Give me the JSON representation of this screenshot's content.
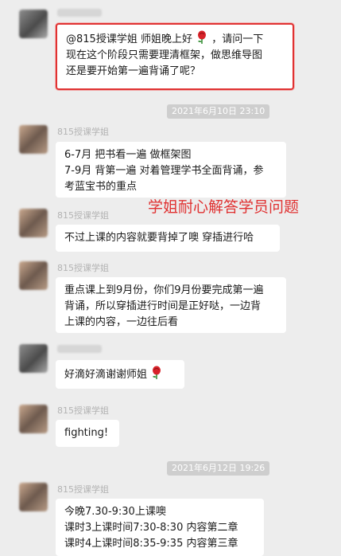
{
  "messages": {
    "m1": {
      "lines": [
        "@815授课学姐 师姐晚上好",
        "，请问一下",
        "现在这个阶段只需要理清框架，做思维导图",
        "还是要开始第一遍背诵了呢？"
      ]
    },
    "time1": "2021年6月10日 23:10",
    "m2": {
      "sender": "815授课学姐",
      "lines": [
        "6-7月 把书看一遍 做框架图",
        "7-9月 背第一遍 对着管理学书全面背诵，参",
        "考蓝宝书的重点"
      ]
    },
    "annotation": "学姐耐心解答学员问题",
    "m3": {
      "sender": "815授课学姐",
      "lines": [
        "不过上课的内容就要背掉了噢 穿插进行哈"
      ]
    },
    "m4": {
      "sender": "815授课学姐",
      "lines": [
        "重点课上到9月份，你们9月份要完成第一遍",
        "背诵，所以穿插进行时间是正好哒，一边背",
        "上课的内容，一边往后看"
      ]
    },
    "m5": {
      "lines": [
        "好滴好滴谢谢师姐"
      ]
    },
    "m6": {
      "sender": "815授课学姐",
      "lines": [
        "fighting!"
      ]
    },
    "time2": "2021年6月12日 19:26",
    "m7": {
      "sender": "815授课学姐",
      "lines": [
        "今晚7.30-9:30上课噢",
        "课时3上课时间7:30-8:30 内容第二章",
        "课时4上课时间8:35-9:35 内容第三章"
      ]
    }
  },
  "icons": {
    "rose": "rose-emoji-icon"
  },
  "colors": {
    "highlight": "#e03232",
    "background": "#ededed",
    "bubble": "#ffffff"
  }
}
